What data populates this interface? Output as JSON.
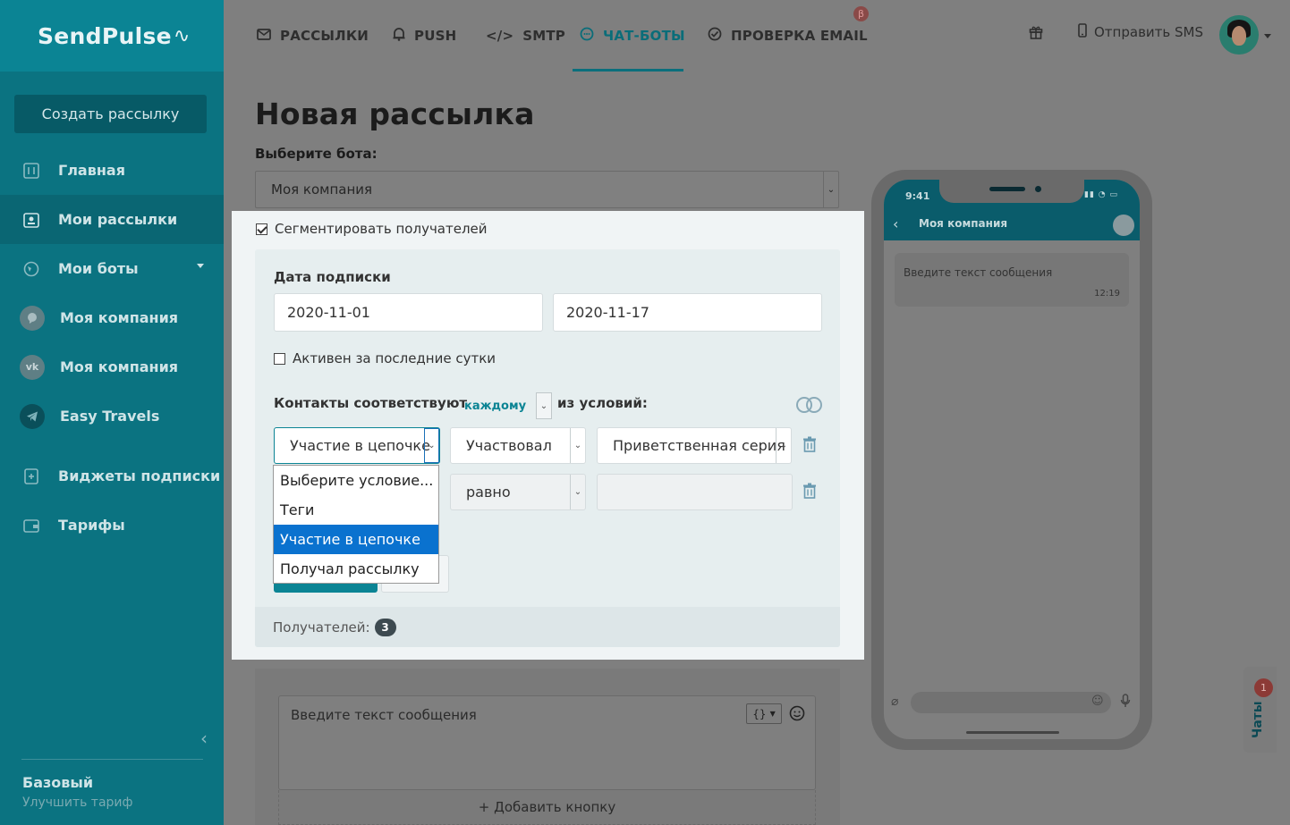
{
  "sidebar": {
    "logo": "SendPulse",
    "create_button": "Создать рассылку",
    "items": [
      {
        "label": "Главная"
      },
      {
        "label": "Мои рассылки"
      },
      {
        "label": "Мои боты"
      },
      {
        "label": "Моя компания"
      },
      {
        "label": "Моя компания"
      },
      {
        "label": "Easy Travels"
      },
      {
        "label": "Виджеты подписки"
      },
      {
        "label": "Тарифы"
      }
    ],
    "plan_name": "Базовый",
    "plan_upgrade": "Улучшить тариф"
  },
  "topnav": {
    "items": [
      {
        "label": "РАССЫЛКИ"
      },
      {
        "label": "PUSH"
      },
      {
        "label": "SMTP"
      },
      {
        "label": "ЧАТ-БОТЫ"
      },
      {
        "label": "ПРОВЕРКА EMAIL"
      }
    ],
    "beta_badge": "β",
    "send_sms": "Отправить SMS"
  },
  "main": {
    "title": "Новая рассылка",
    "bot_label": "Выберите бота:",
    "bot_selected": "Моя компания"
  },
  "segment": {
    "checkbox_label": "Сегментировать получателей",
    "checked": true,
    "date_label": "Дата подписки",
    "date_from": "2020-11-01",
    "date_to": "2020-11-17",
    "active_label": "Активен за последние сутки",
    "active_checked": false,
    "contacts_label": "Контакты соответствуют",
    "match_mode": "каждому",
    "conditions_label": "из условий:",
    "rule1": {
      "field": "Участие в цепочке",
      "operator": "Участвовал",
      "value": "Приветственная серия"
    },
    "rule2": {
      "operator": "равно",
      "value": ""
    },
    "dropdown_options": [
      {
        "label": "Выберите условие..."
      },
      {
        "label": "Теги"
      },
      {
        "label": "Участие в цепочке"
      },
      {
        "label": "Получал рассылку"
      }
    ],
    "recipients_label": "Получателей:",
    "recipients_count": "3"
  },
  "composer": {
    "placeholder": "Введите текст сообщения",
    "add_button": "+ Добавить кнопку"
  },
  "phone": {
    "time": "9:41",
    "chat_title": "Моя компания",
    "bubble_text": "Введите текст сообщения",
    "bubble_time": "12:19"
  },
  "chats_tab": {
    "label": "Чаты",
    "badge": "1"
  },
  "colors": {
    "sidebar": "#0b7381",
    "accent": "#0b8494",
    "selected_option": "#0a72cf"
  }
}
